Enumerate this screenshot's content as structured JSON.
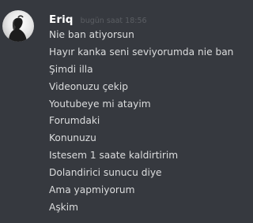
{
  "message": {
    "author": "Eriq",
    "timestamp": "bugün saat 18:56",
    "avatar_icon": "user-avatar-icon",
    "lines": [
      "Nie ban atiyorsun",
      "Hayır kanka seni seviyorumda nie ban",
      "Şimdi illa",
      "Videonuzu çekip",
      "Youtubeye mi atayim",
      "Forumdaki",
      "Konunuzu",
      "Istesem 1 saate kaldirtirim",
      "Dolandirici sunucu diye",
      "Ama yapmiyorum",
      "Aşkim"
    ]
  },
  "colors": {
    "background": "#36393f",
    "username": "#ffffff",
    "message_text": "#dcddde",
    "timestamp": "#5b5e63"
  }
}
